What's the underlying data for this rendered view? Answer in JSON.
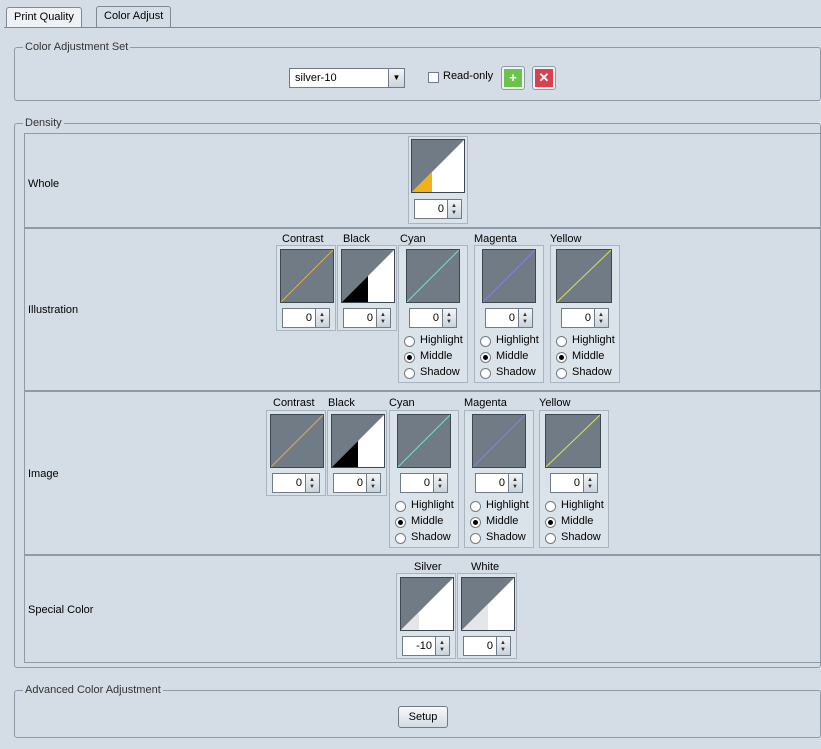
{
  "tabs": [
    {
      "label": "Print Quality"
    },
    {
      "label": "Color Adjust"
    }
  ],
  "color_adjustment_set": {
    "title": "Color Adjustment Set",
    "selected": "silver-10",
    "readonly_label": "Read-only",
    "add_icon": "plus-icon",
    "delete_icon": "x-icon",
    "add_color": "#6cc24a",
    "delete_color": "#d9414e"
  },
  "density": {
    "title": "Density",
    "whole": {
      "label": "Whole",
      "value": "0",
      "accent": "#f0b21a"
    },
    "illustration": {
      "label": "Illustration",
      "headers": [
        "Contrast",
        "Black",
        "Cyan",
        "Magenta",
        "Yellow"
      ],
      "values": [
        "0",
        "0",
        "0",
        "0",
        "0"
      ],
      "radio_labels": [
        "Highlight",
        "Middle",
        "Shadow"
      ],
      "selected": "Middle"
    },
    "image": {
      "label": "Image",
      "headers": [
        "Contrast",
        "Black",
        "Cyan",
        "Magenta",
        "Yellow"
      ],
      "values": [
        "0",
        "0",
        "0",
        "0",
        "0"
      ],
      "radio_labels": [
        "Highlight",
        "Middle",
        "Shadow"
      ],
      "selected": "Middle"
    },
    "special_color": {
      "label": "Special Color",
      "headers": [
        "Silver",
        "White"
      ],
      "values": [
        "-10",
        "0"
      ]
    }
  },
  "advanced": {
    "title": "Advanced Color Adjustment",
    "setup_label": "Setup"
  },
  "curve_colors": {
    "contrast": "#d9b24a",
    "cyan": "#7fd7d0",
    "magenta": "#8a7fe0",
    "yellow": "#d8e05a"
  }
}
